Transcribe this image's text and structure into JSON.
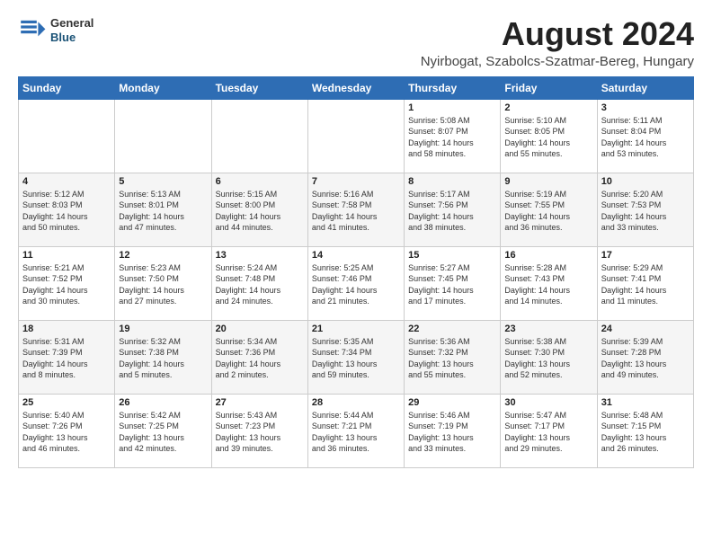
{
  "logo": {
    "general": "General",
    "blue": "Blue"
  },
  "header": {
    "month_year": "August 2024",
    "location": "Nyirbogat, Szabolcs-Szatmar-Bereg, Hungary"
  },
  "days_of_week": [
    "Sunday",
    "Monday",
    "Tuesday",
    "Wednesday",
    "Thursday",
    "Friday",
    "Saturday"
  ],
  "weeks": [
    [
      {
        "day": "",
        "detail": ""
      },
      {
        "day": "",
        "detail": ""
      },
      {
        "day": "",
        "detail": ""
      },
      {
        "day": "",
        "detail": ""
      },
      {
        "day": "1",
        "detail": "Sunrise: 5:08 AM\nSunset: 8:07 PM\nDaylight: 14 hours\nand 58 minutes."
      },
      {
        "day": "2",
        "detail": "Sunrise: 5:10 AM\nSunset: 8:05 PM\nDaylight: 14 hours\nand 55 minutes."
      },
      {
        "day": "3",
        "detail": "Sunrise: 5:11 AM\nSunset: 8:04 PM\nDaylight: 14 hours\nand 53 minutes."
      }
    ],
    [
      {
        "day": "4",
        "detail": "Sunrise: 5:12 AM\nSunset: 8:03 PM\nDaylight: 14 hours\nand 50 minutes."
      },
      {
        "day": "5",
        "detail": "Sunrise: 5:13 AM\nSunset: 8:01 PM\nDaylight: 14 hours\nand 47 minutes."
      },
      {
        "day": "6",
        "detail": "Sunrise: 5:15 AM\nSunset: 8:00 PM\nDaylight: 14 hours\nand 44 minutes."
      },
      {
        "day": "7",
        "detail": "Sunrise: 5:16 AM\nSunset: 7:58 PM\nDaylight: 14 hours\nand 41 minutes."
      },
      {
        "day": "8",
        "detail": "Sunrise: 5:17 AM\nSunset: 7:56 PM\nDaylight: 14 hours\nand 38 minutes."
      },
      {
        "day": "9",
        "detail": "Sunrise: 5:19 AM\nSunset: 7:55 PM\nDaylight: 14 hours\nand 36 minutes."
      },
      {
        "day": "10",
        "detail": "Sunrise: 5:20 AM\nSunset: 7:53 PM\nDaylight: 14 hours\nand 33 minutes."
      }
    ],
    [
      {
        "day": "11",
        "detail": "Sunrise: 5:21 AM\nSunset: 7:52 PM\nDaylight: 14 hours\nand 30 minutes."
      },
      {
        "day": "12",
        "detail": "Sunrise: 5:23 AM\nSunset: 7:50 PM\nDaylight: 14 hours\nand 27 minutes."
      },
      {
        "day": "13",
        "detail": "Sunrise: 5:24 AM\nSunset: 7:48 PM\nDaylight: 14 hours\nand 24 minutes."
      },
      {
        "day": "14",
        "detail": "Sunrise: 5:25 AM\nSunset: 7:46 PM\nDaylight: 14 hours\nand 21 minutes."
      },
      {
        "day": "15",
        "detail": "Sunrise: 5:27 AM\nSunset: 7:45 PM\nDaylight: 14 hours\nand 17 minutes."
      },
      {
        "day": "16",
        "detail": "Sunrise: 5:28 AM\nSunset: 7:43 PM\nDaylight: 14 hours\nand 14 minutes."
      },
      {
        "day": "17",
        "detail": "Sunrise: 5:29 AM\nSunset: 7:41 PM\nDaylight: 14 hours\nand 11 minutes."
      }
    ],
    [
      {
        "day": "18",
        "detail": "Sunrise: 5:31 AM\nSunset: 7:39 PM\nDaylight: 14 hours\nand 8 minutes."
      },
      {
        "day": "19",
        "detail": "Sunrise: 5:32 AM\nSunset: 7:38 PM\nDaylight: 14 hours\nand 5 minutes."
      },
      {
        "day": "20",
        "detail": "Sunrise: 5:34 AM\nSunset: 7:36 PM\nDaylight: 14 hours\nand 2 minutes."
      },
      {
        "day": "21",
        "detail": "Sunrise: 5:35 AM\nSunset: 7:34 PM\nDaylight: 13 hours\nand 59 minutes."
      },
      {
        "day": "22",
        "detail": "Sunrise: 5:36 AM\nSunset: 7:32 PM\nDaylight: 13 hours\nand 55 minutes."
      },
      {
        "day": "23",
        "detail": "Sunrise: 5:38 AM\nSunset: 7:30 PM\nDaylight: 13 hours\nand 52 minutes."
      },
      {
        "day": "24",
        "detail": "Sunrise: 5:39 AM\nSunset: 7:28 PM\nDaylight: 13 hours\nand 49 minutes."
      }
    ],
    [
      {
        "day": "25",
        "detail": "Sunrise: 5:40 AM\nSunset: 7:26 PM\nDaylight: 13 hours\nand 46 minutes."
      },
      {
        "day": "26",
        "detail": "Sunrise: 5:42 AM\nSunset: 7:25 PM\nDaylight: 13 hours\nand 42 minutes."
      },
      {
        "day": "27",
        "detail": "Sunrise: 5:43 AM\nSunset: 7:23 PM\nDaylight: 13 hours\nand 39 minutes."
      },
      {
        "day": "28",
        "detail": "Sunrise: 5:44 AM\nSunset: 7:21 PM\nDaylight: 13 hours\nand 36 minutes."
      },
      {
        "day": "29",
        "detail": "Sunrise: 5:46 AM\nSunset: 7:19 PM\nDaylight: 13 hours\nand 33 minutes."
      },
      {
        "day": "30",
        "detail": "Sunrise: 5:47 AM\nSunset: 7:17 PM\nDaylight: 13 hours\nand 29 minutes."
      },
      {
        "day": "31",
        "detail": "Sunrise: 5:48 AM\nSunset: 7:15 PM\nDaylight: 13 hours\nand 26 minutes."
      }
    ]
  ]
}
